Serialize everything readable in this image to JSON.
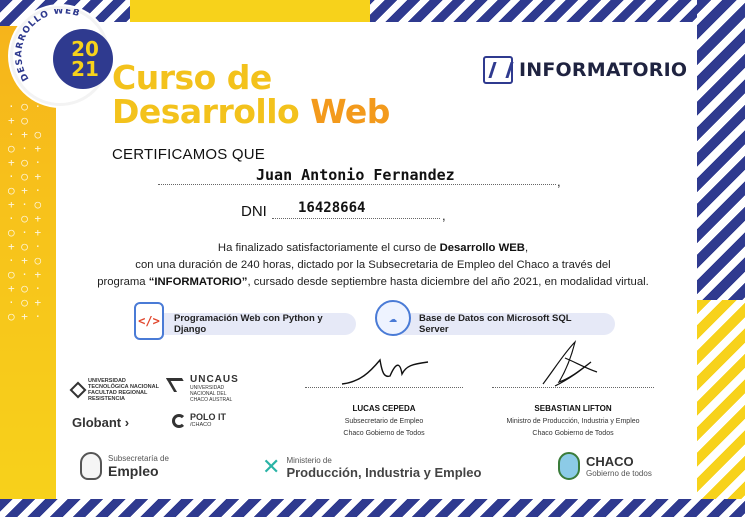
{
  "badge": {
    "arc_text": "DESARROLLO WEB",
    "year": "20\n21"
  },
  "title": {
    "line1": "Curso de",
    "line2_part1": "Desarrollo ",
    "line2_part2": "Web"
  },
  "logo": {
    "name": "INFORMATORIO"
  },
  "certify": "CERTIFICAMOS QUE",
  "recipient": {
    "name": "Juan Antonio Fernandez",
    "dni_label": "DNI",
    "dni": "16428664"
  },
  "paragraph": {
    "l1_a": "Ha finalizado satisfactoriamente el curso de ",
    "l1_b": "Desarrollo WEB",
    "l1_c": ",",
    "l2": "con una duración de 240 horas, dictado por la Subsecretaria de Empleo del Chaco a través del",
    "l3_a": "programa ",
    "l3_b": "“INFORMATORIO”",
    "l3_c": ", cursado desde septiembre hasta diciembre del año 2021, en modalidad virtual."
  },
  "skills": [
    {
      "label": "Programación Web con Python y Django",
      "icon": "code-file-icon"
    },
    {
      "label": "Base de Datos con Microsoft SQL Server",
      "icon": "database-cloud-icon"
    }
  ],
  "sponsors": {
    "utn": "UNIVERSIDAD\nTECNOLÓGICA NACIONAL\nFACULTAD REGIONAL\nRESISTENCIA",
    "uncaus_title": "UNCAUS",
    "uncaus_sub": "UNIVERSIDAD\nNACIONAL DEL\nCHACO AUSTRAL",
    "globant": "Globant",
    "polo_title": "POLO IT",
    "polo_sub": "/CHACO"
  },
  "signatures": [
    {
      "name": "LUCAS CEPEDA",
      "role1": "Subsecretario de Empleo",
      "role2": "Chaco Gobierno de Todos"
    },
    {
      "name": "SEBASTIAN LIFTON",
      "role1": "Ministro de Producción, Industria y Empleo",
      "role2": "Chaco Gobierno de Todos"
    }
  ],
  "bottom": {
    "empleo_sub": "Subsecretaría de",
    "empleo_main": "Empleo",
    "min_sub": "Ministerio de",
    "min_main": "Producción, Industria y Empleo",
    "chaco_main": "CHACO",
    "chaco_sub": "Gobierno de todos"
  },
  "colors": {
    "navy": "#2f3a8f",
    "yellow": "#f7d21b",
    "orange": "#f39a1c",
    "teal": "#2ab3a6"
  }
}
